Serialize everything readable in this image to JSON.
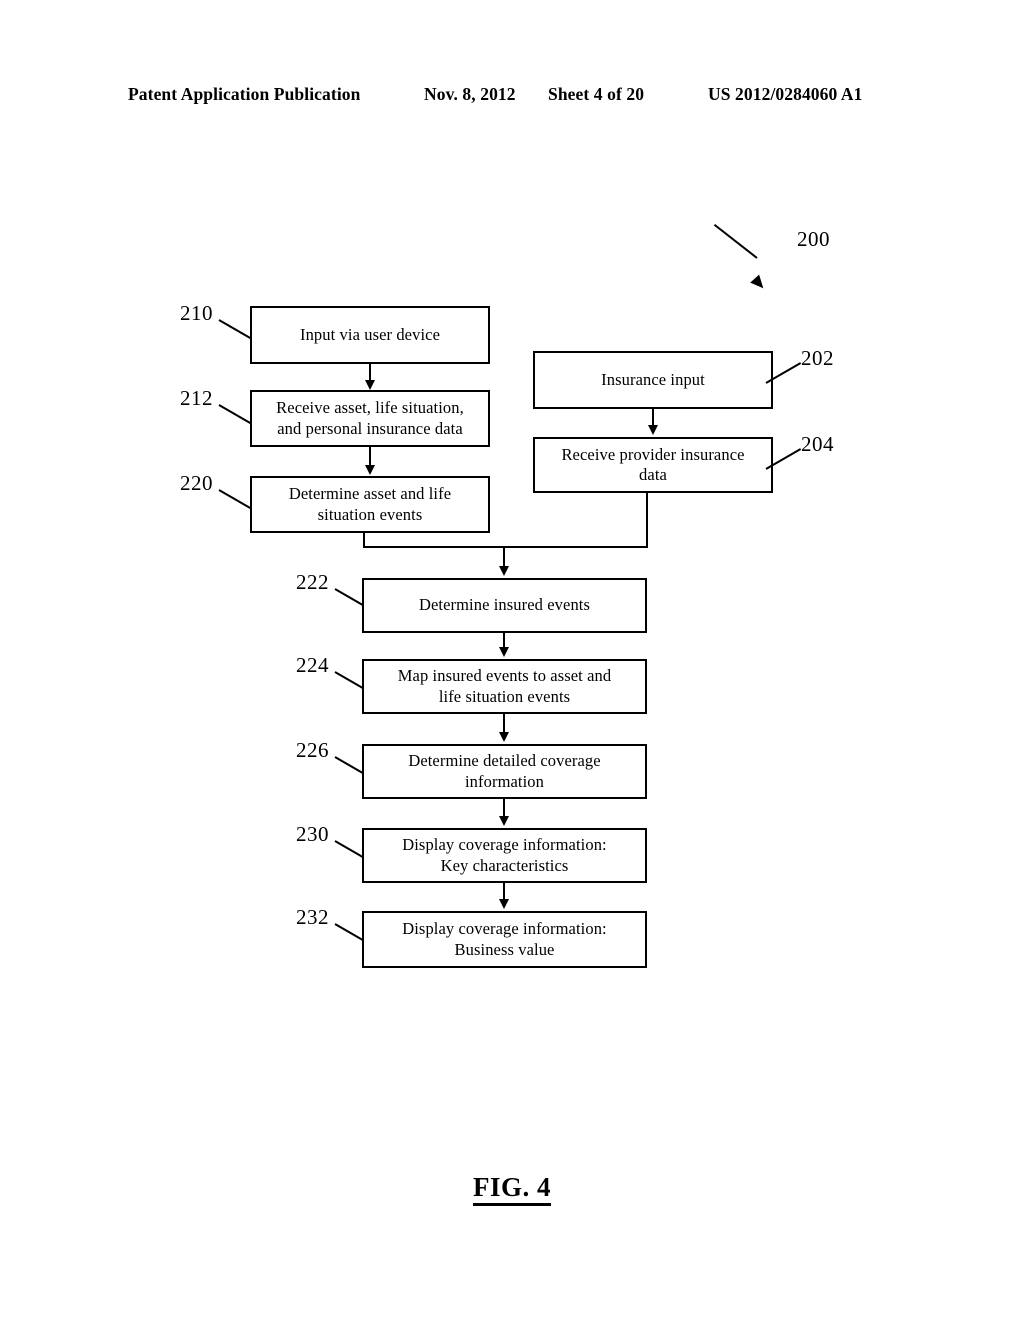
{
  "header": {
    "publication": "Patent Application Publication",
    "date": "Nov. 8, 2012",
    "sheet": "Sheet 4 of 20",
    "patent_number": "US 2012/0284060 A1"
  },
  "figure": {
    "caption": "FIG. 4",
    "system_label": "200"
  },
  "flowchart": {
    "left_branch": [
      {
        "ref": "210",
        "text": "Input via user device"
      },
      {
        "ref": "212",
        "line1": "Receive asset, life situation,",
        "line2": "and personal insurance data"
      },
      {
        "ref": "220",
        "line1": "Determine asset and life",
        "line2": "situation events"
      }
    ],
    "right_branch": [
      {
        "ref": "202",
        "text": "Insurance input"
      },
      {
        "ref": "204",
        "line1": "Receive provider insurance",
        "line2": "data"
      }
    ],
    "merged_steps": [
      {
        "ref": "222",
        "text": "Determine insured events"
      },
      {
        "ref": "224",
        "line1": "Map insured events to asset and",
        "line2": "life situation events"
      },
      {
        "ref": "226",
        "line1": "Determine detailed coverage",
        "line2": "information"
      },
      {
        "ref": "230",
        "line1": "Display coverage information:",
        "line2": "Key characteristics"
      },
      {
        "ref": "232",
        "line1": "Display coverage information:",
        "line2": "Business value"
      }
    ]
  },
  "colors": {
    "ink": "#000000",
    "paper": "#ffffff"
  }
}
